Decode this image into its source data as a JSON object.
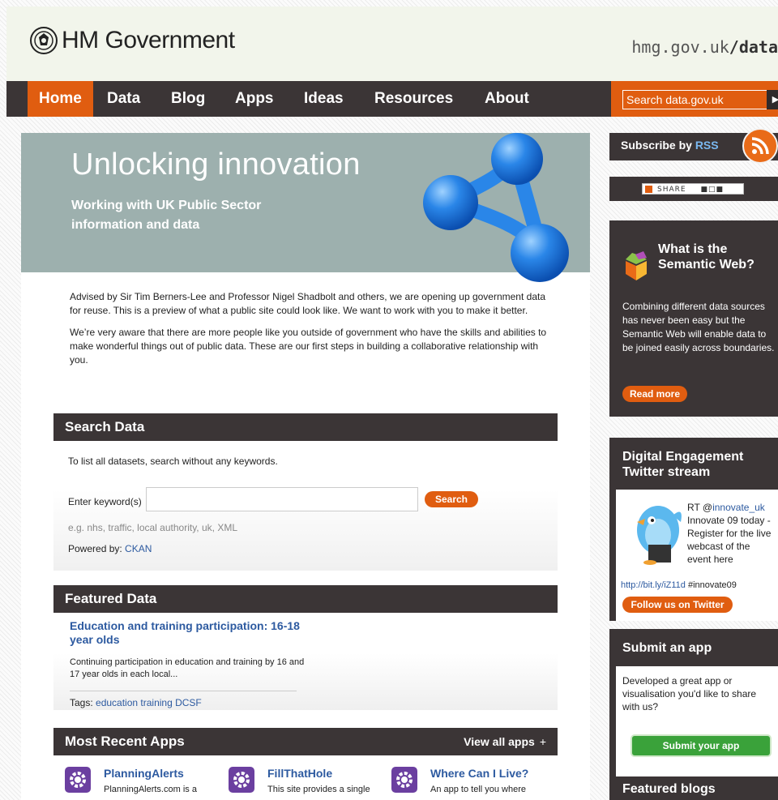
{
  "header": {
    "logo_text": "HM Government",
    "url_prefix": "hmg.gov.uk",
    "url_suffix": "/data"
  },
  "nav": {
    "items": [
      {
        "label": "Home",
        "active": true
      },
      {
        "label": "Data"
      },
      {
        "label": "Blog"
      },
      {
        "label": "Apps"
      },
      {
        "label": "Ideas"
      },
      {
        "label": "Resources"
      },
      {
        "label": "About"
      }
    ],
    "search_placeholder": "Search data.gov.uk",
    "go_icon": "arrow-right-icon"
  },
  "hero": {
    "title": "Unlocking innovation",
    "subtitle": "Working with UK Public Sector information and data"
  },
  "intro": {
    "p1": "Advised by Sir Tim Berners-Lee and Professor Nigel Shadbolt and others, we are opening up government data for reuse. This is a preview of what a public site could look like. We want to work with you to make it better.",
    "p2": "We’re very aware that there are more people like you outside of government who have the skills and abilities to make wonderful things out of public data. These are our first steps in building a collaborative relationship with you."
  },
  "search_data": {
    "heading": "Search Data",
    "hint": "To list all datasets, search without any keywords.",
    "keyword_label": "Enter keyword(s)",
    "keyword_value": "",
    "button": "Search",
    "example": "e.g. nhs, traffic, local authority, uk, XML",
    "powered_label": "Powered by:",
    "powered_link": "CKAN"
  },
  "featured_data": {
    "heading": "Featured Data",
    "title": "Education and training participation: 16-18 year olds",
    "desc": "Continuing participation in education and training by 16 and 17 year olds in each local...",
    "tags_label": "Tags:",
    "tags": "education training DCSF"
  },
  "recent_apps": {
    "heading": "Most Recent Apps",
    "view_all": "View all apps",
    "plus": "+",
    "items": [
      {
        "title": "PlanningAlerts",
        "desc": "PlanningAlerts.com is a"
      },
      {
        "title": "FillThatHole",
        "desc": "This site provides a single"
      },
      {
        "title": "Where Can I Live?",
        "desc": "An app to tell you where"
      }
    ]
  },
  "sidebar": {
    "rss_label": "Subscribe by ",
    "rss_highlight": "RSS",
    "share_label": "SHARE",
    "semantic": {
      "title": "What is the Semantic Web?",
      "desc": "Combining different data sources has never been easy but the Semantic Web will enable data to be joined easily across boundaries.",
      "button": "Read more"
    },
    "twitter": {
      "title": "Digital Engagement Twitter stream",
      "tweet_prefix": "RT @",
      "tweet_handle": "innovate_uk",
      "tweet_text": "Innovate 09 today - Register for the live webcast of the event here",
      "tweet_link": "http://bit.ly/iZ11d",
      "tweet_hashtag": " #innovate09",
      "button": "Follow us on Twitter"
    },
    "submit": {
      "title": "Submit an app",
      "desc": "Developed a great app or visualisation you'd like to share with us?",
      "button": "Submit your app"
    },
    "blogs": {
      "title": "Featured blogs"
    }
  },
  "colors": {
    "accent": "#e05d10",
    "dark": "#3b3536",
    "link": "#2d5aa0",
    "hero_bg": "#9db0ae",
    "app_icon": "#6b3fa0",
    "green": "#3aa23a"
  }
}
